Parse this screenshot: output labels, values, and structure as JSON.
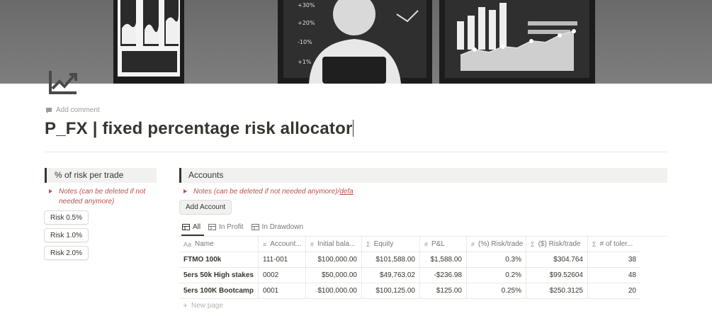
{
  "page": {
    "title": "P_FX | fixed percentage risk allocator",
    "add_comment": "Add comment",
    "icon": "chart-line-up-icon"
  },
  "cover": {
    "panel_labels": [
      "+30%",
      "+20%",
      "-10%",
      "+1%"
    ]
  },
  "left": {
    "heading": "% of risk per trade",
    "toggle_note": "Notes (can be deleted if not needed anymore)",
    "buttons": [
      "Risk 0.5%",
      "Risk 1.0%",
      "Risk 2.0%"
    ]
  },
  "right": {
    "heading": "Accounts",
    "toggle_note": "Notes (can be deleted if not needed anymore)/",
    "toggle_note_link": "defa",
    "add_account": "Add Account",
    "tabs": [
      {
        "label": "All",
        "icon": "table-icon",
        "active": true
      },
      {
        "label": "In Profit",
        "icon": "table-icon",
        "active": false
      },
      {
        "label": "In Drawdown",
        "icon": "table-icon",
        "active": false
      }
    ],
    "columns": [
      {
        "icon": "Aa",
        "label": "Name"
      },
      {
        "icon": "≡",
        "label": "Account..."
      },
      {
        "icon": "#",
        "label": "Initial bala..."
      },
      {
        "icon": "Σ",
        "label": "Equity"
      },
      {
        "icon": "#",
        "label": "P&L"
      },
      {
        "icon": "#",
        "label": "(%) Risk/trade"
      },
      {
        "icon": "Σ",
        "label": "($) Risk/trade"
      },
      {
        "icon": "Σ",
        "label": "# of toler..."
      }
    ],
    "rows": [
      [
        "FTMO 100k",
        "111-001",
        "$100,000.00",
        "$101,588.00",
        "$1,588.00",
        "0.3%",
        "$304.764",
        "38"
      ],
      [
        "5ers 50k High stakes",
        "0002",
        "$50,000.00",
        "$49,763.02",
        "-$236.98",
        "0.2%",
        "$99.52604",
        "48"
      ],
      [
        "5ers 100K Bootcamp",
        "0001",
        "$100,000.00",
        "$100,125.00",
        "$125.00",
        "0.25%",
        "$250.3125",
        "20"
      ]
    ],
    "new_page": "New page"
  }
}
